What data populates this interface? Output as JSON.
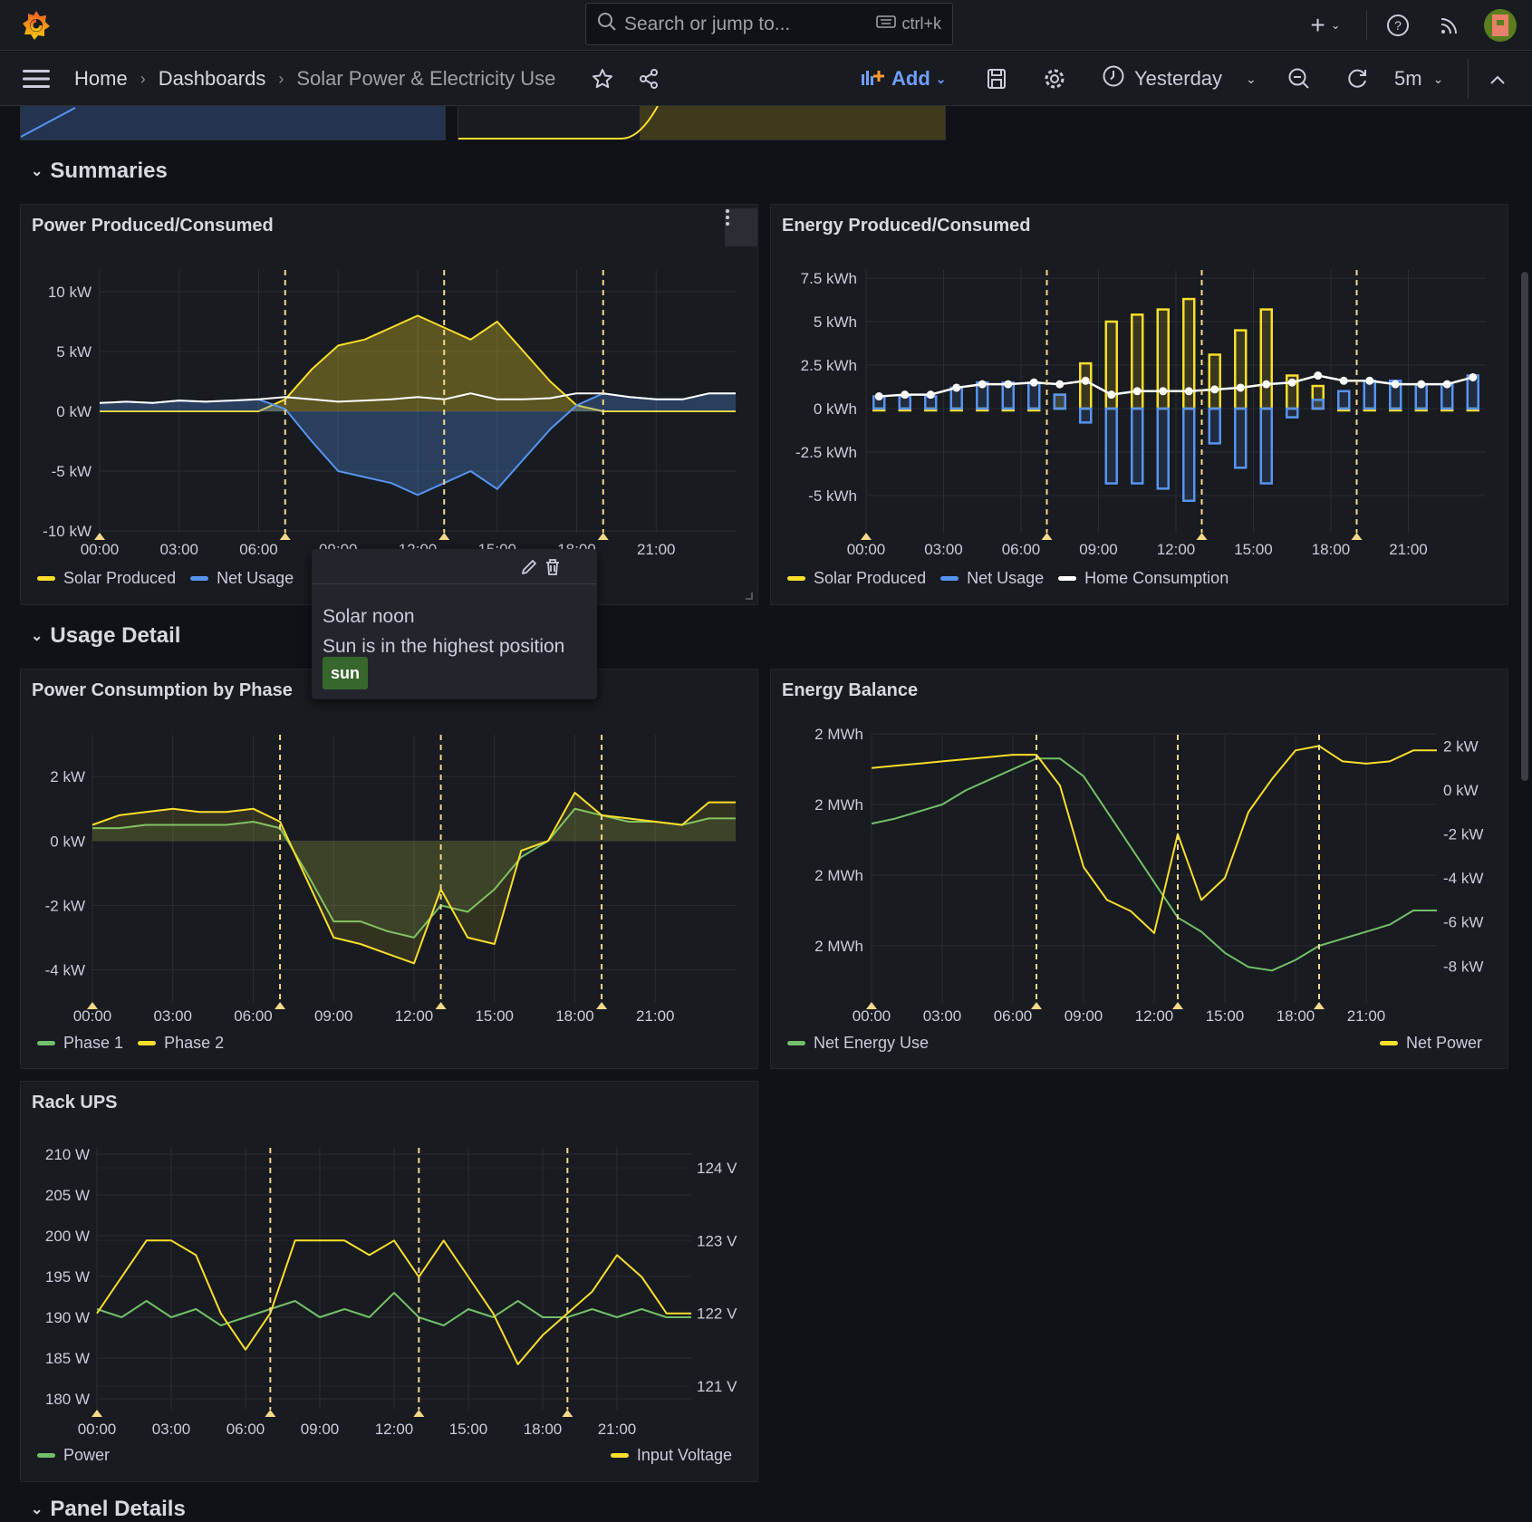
{
  "topbar": {
    "search_placeholder": "Search or jump to...",
    "shortcut": "ctrl+k"
  },
  "toolbar": {
    "breadcrumb": [
      "Home",
      "Dashboards",
      "Solar Power & Electricity Use"
    ],
    "add_label": "Add",
    "time_range": "Yesterday",
    "refresh_interval": "5m"
  },
  "rows": [
    {
      "title": "Summaries"
    },
    {
      "title": "Usage Detail"
    },
    {
      "title": "Panel Details"
    }
  ],
  "colors": {
    "solar": "#fade2a",
    "net": "#5794f2",
    "home": "#ffffff",
    "green": "#73bf69",
    "annotation": "#f4d98a",
    "accent": "#6e9fff",
    "background": "#111217",
    "panel": "#181b1f",
    "tag": "#37672d"
  },
  "annotations": {
    "lines": [
      "07:00",
      "13:00",
      "19:00"
    ],
    "markers": [
      "00:00",
      "07:00",
      "13:00",
      "19:00"
    ]
  },
  "tooltip": {
    "title": "Solar noon",
    "text": "Sun is in the highest position",
    "tag": "sun"
  },
  "chart_data": [
    {
      "title": "Power Produced/Consumed",
      "type": "line",
      "x": [
        "00:00",
        "01:00",
        "02:00",
        "03:00",
        "04:00",
        "05:00",
        "06:00",
        "07:00",
        "08:00",
        "09:00",
        "10:00",
        "11:00",
        "12:00",
        "13:00",
        "14:00",
        "15:00",
        "16:00",
        "17:00",
        "18:00",
        "19:00",
        "20:00",
        "21:00",
        "22:00",
        "23:00"
      ],
      "xticks": [
        "00:00",
        "03:00",
        "06:00",
        "09:00",
        "12:00",
        "15:00",
        "18:00",
        "21:00"
      ],
      "ylim": [
        -10,
        10
      ],
      "yticks": [
        10,
        5,
        0,
        -5,
        -10
      ],
      "ytick_labels": [
        "10 kW",
        "5 kW",
        "0 kW",
        "-5 kW",
        "-10 kW"
      ],
      "series": [
        {
          "name": "Solar Produced",
          "color": "#fade2a",
          "fill": true,
          "values": [
            0,
            0,
            0,
            0,
            0,
            0,
            0,
            1.0,
            3.5,
            5.5,
            6,
            7,
            8,
            7,
            6,
            7.5,
            5,
            2.5,
            0.5,
            0,
            0,
            0,
            0,
            0
          ]
        },
        {
          "name": "Net Usage",
          "color": "#5794f2",
          "fill": true,
          "values": [
            0.7,
            0.8,
            0.7,
            0.9,
            0.8,
            0.9,
            1.0,
            0.2,
            -2.5,
            -5,
            -5.5,
            -6,
            -7,
            -6,
            -5,
            -6.5,
            -4,
            -1.5,
            0.5,
            1.5,
            1.2,
            1.0,
            1.0,
            1.5
          ]
        },
        {
          "name": "Home Consumption",
          "color": "#ffffff",
          "fill": false,
          "values": [
            0.7,
            0.8,
            0.7,
            0.9,
            0.8,
            0.9,
            1.0,
            1.2,
            1.0,
            0.8,
            0.9,
            1.0,
            1.2,
            1.0,
            1.5,
            1.0,
            1.0,
            1.1,
            1.5,
            1.5,
            1.2,
            1.0,
            1.0,
            1.5
          ]
        }
      ],
      "legend": [
        "Solar Produced",
        "Net Usage"
      ]
    },
    {
      "title": "Energy Produced/Consumed",
      "type": "bar",
      "x": [
        "00:00",
        "01:00",
        "02:00",
        "03:00",
        "04:00",
        "05:00",
        "06:00",
        "07:00",
        "08:00",
        "09:00",
        "10:00",
        "11:00",
        "12:00",
        "13:00",
        "14:00",
        "15:00",
        "16:00",
        "17:00",
        "18:00",
        "19:00",
        "20:00",
        "21:00",
        "22:00",
        "23:00"
      ],
      "xticks": [
        "00:00",
        "03:00",
        "06:00",
        "09:00",
        "12:00",
        "15:00",
        "18:00",
        "21:00"
      ],
      "ylim": [
        -7.5,
        7.5
      ],
      "yticks": [
        7.5,
        5,
        2.5,
        0,
        -2.5,
        -5
      ],
      "ytick_labels": [
        "7.5 kWh",
        "5 kWh",
        "2.5 kWh",
        "0 kWh",
        "-2.5 kWh",
        "-5 kWh"
      ],
      "series": [
        {
          "name": "Solar Produced",
          "color": "#fade2a",
          "values": [
            0,
            0,
            0,
            0,
            0,
            0,
            0,
            0.8,
            2.6,
            5.0,
            5.4,
            5.7,
            6.3,
            3.1,
            4.5,
            5.7,
            1.9,
            1.3,
            0,
            0,
            0,
            0,
            0,
            0
          ]
        },
        {
          "name": "Net Usage",
          "color": "#5794f2",
          "values": [
            0.7,
            0.7,
            0.7,
            1.2,
            1.5,
            1.5,
            1.5,
            0.8,
            -0.8,
            -4.3,
            -4.3,
            -4.6,
            -5.3,
            -2.0,
            -3.4,
            -4.3,
            -0.5,
            0.5,
            1.0,
            1.6,
            1.6,
            1.4,
            1.4,
            1.9
          ]
        },
        {
          "name": "Home Consumption",
          "color": "#ffffff",
          "values": [
            0.7,
            0.8,
            0.8,
            1.2,
            1.4,
            1.4,
            1.5,
            1.4,
            1.6,
            0.8,
            1.0,
            1.0,
            1.0,
            1.1,
            1.2,
            1.4,
            1.5,
            1.9,
            1.6,
            1.6,
            1.4,
            1.4,
            1.4,
            1.8
          ]
        }
      ],
      "legend": [
        "Solar Produced",
        "Net Usage",
        "Home Consumption"
      ]
    },
    {
      "title": "Power Consumption by Phase",
      "type": "line",
      "x": [
        "00:00",
        "01:00",
        "02:00",
        "03:00",
        "04:00",
        "05:00",
        "06:00",
        "07:00",
        "08:00",
        "09:00",
        "10:00",
        "11:00",
        "12:00",
        "13:00",
        "14:00",
        "15:00",
        "16:00",
        "17:00",
        "18:00",
        "19:00",
        "20:00",
        "21:00",
        "22:00",
        "23:00"
      ],
      "xticks": [
        "00:00",
        "03:00",
        "06:00",
        "09:00",
        "12:00",
        "15:00",
        "18:00",
        "21:00"
      ],
      "ylim": [
        -5,
        3.3
      ],
      "yticks": [
        2,
        0,
        -2,
        -4
      ],
      "ytick_labels": [
        "2 kW",
        "0 kW",
        "-2 kW",
        "-4 kW"
      ],
      "series": [
        {
          "name": "Phase 1",
          "color": "#73bf69",
          "values": [
            0.4,
            0.4,
            0.5,
            0.5,
            0.5,
            0.5,
            0.6,
            0.4,
            -1.0,
            -2.5,
            -2.5,
            -2.8,
            -3.0,
            -2.0,
            -2.2,
            -1.5,
            -0.5,
            0.0,
            1.0,
            0.8,
            0.6,
            0.6,
            0.5,
            0.7
          ]
        },
        {
          "name": "Phase 2",
          "color": "#fade2a",
          "values": [
            0.5,
            0.8,
            0.9,
            1.0,
            0.9,
            0.9,
            1.0,
            0.6,
            -1.2,
            -3.0,
            -3.2,
            -3.5,
            -3.8,
            -1.5,
            -3.0,
            -3.2,
            -0.3,
            0.0,
            1.5,
            0.8,
            0.7,
            0.6,
            0.5,
            1.2
          ]
        }
      ],
      "legend": [
        "Phase 1",
        "Phase 2"
      ]
    },
    {
      "title": "Energy Balance",
      "type": "line",
      "x": [
        "00:00",
        "01:00",
        "02:00",
        "03:00",
        "04:00",
        "05:00",
        "06:00",
        "07:00",
        "08:00",
        "09:00",
        "10:00",
        "11:00",
        "12:00",
        "13:00",
        "14:00",
        "15:00",
        "16:00",
        "17:00",
        "18:00",
        "19:00",
        "20:00",
        "21:00",
        "22:00",
        "23:00"
      ],
      "xticks": [
        "00:00",
        "03:00",
        "06:00",
        "09:00",
        "12:00",
        "15:00",
        "18:00",
        "21:00"
      ],
      "yticks": [
        2.03,
        2.02,
        2.01,
        2.0
      ],
      "ytick_labels": [
        "2  MWh",
        "2  MWh",
        "2  MWh",
        "2  MWh"
      ],
      "y2lim": [
        -8.4,
        2.8
      ],
      "y2ticks": [
        2,
        0,
        -2,
        -4,
        -6,
        -8
      ],
      "y2tick_labels": [
        "2 kW",
        "0 kW",
        "-2 kW",
        "-4 kW",
        "-6 kW",
        "-8 kW"
      ],
      "series": [
        {
          "name": "Net Energy Use",
          "color": "#73bf69",
          "axis": "left",
          "values": [
            2.0173,
            2.018,
            2.019,
            2.02,
            2.022,
            2.0235,
            2.025,
            2.0265,
            2.0265,
            2.024,
            2.019,
            2.014,
            2.009,
            2.004,
            2.002,
            1.999,
            1.997,
            1.9965,
            1.998,
            2.0,
            2.001,
            2.002,
            2.003,
            2.005
          ]
        },
        {
          "name": "Net Power",
          "color": "#fade2a",
          "axis": "right",
          "values": [
            1.0,
            1.1,
            1.2,
            1.3,
            1.4,
            1.5,
            1.6,
            1.6,
            0.2,
            -3.5,
            -5,
            -5.5,
            -6.5,
            -2,
            -5,
            -4,
            -1,
            0.5,
            1.8,
            2.0,
            1.3,
            1.2,
            1.3,
            1.8
          ]
        }
      ],
      "legend": [
        "Net Energy Use",
        "Net Power"
      ]
    },
    {
      "title": "Rack UPS",
      "type": "line",
      "x": [
        "00:00",
        "01:00",
        "02:00",
        "03:00",
        "04:00",
        "05:00",
        "06:00",
        "07:00",
        "08:00",
        "09:00",
        "10:00",
        "11:00",
        "12:00",
        "13:00",
        "14:00",
        "15:00",
        "16:00",
        "17:00",
        "18:00",
        "19:00",
        "20:00",
        "21:00",
        "22:00",
        "23:00"
      ],
      "xticks": [
        "00:00",
        "03:00",
        "06:00",
        "09:00",
        "12:00",
        "15:00",
        "18:00",
        "21:00"
      ],
      "ylim": [
        178.9,
        212
      ],
      "yticks": [
        210,
        205,
        200,
        195,
        190,
        185,
        180
      ],
      "ytick_labels": [
        "210 W",
        "205 W",
        "200 W",
        "195 W",
        "190 W",
        "185 W",
        "180 W"
      ],
      "y2lim": [
        120.6,
        124.3
      ],
      "y2ticks": [
        124,
        123,
        122,
        121
      ],
      "y2tick_labels": [
        "124 V",
        "123 V",
        "122 V",
        "121 V"
      ],
      "series": [
        {
          "name": "Power",
          "color": "#73bf69",
          "axis": "left",
          "values": [
            191,
            190,
            192,
            190,
            191,
            189,
            190,
            191,
            192,
            190,
            191,
            190,
            193,
            190,
            189,
            191,
            190,
            192,
            190,
            190,
            191,
            190,
            191,
            190
          ]
        },
        {
          "name": "Input Voltage",
          "color": "#fade2a",
          "axis": "right",
          "values": [
            122,
            122.5,
            123,
            123,
            122.8,
            122,
            121.5,
            122,
            123,
            123,
            123,
            122.8,
            123,
            122.5,
            123,
            122.5,
            122,
            121.3,
            121.7,
            122,
            122.3,
            122.8,
            122.5,
            122
          ]
        }
      ],
      "legend": [
        "Power",
        "Input Voltage"
      ]
    }
  ]
}
